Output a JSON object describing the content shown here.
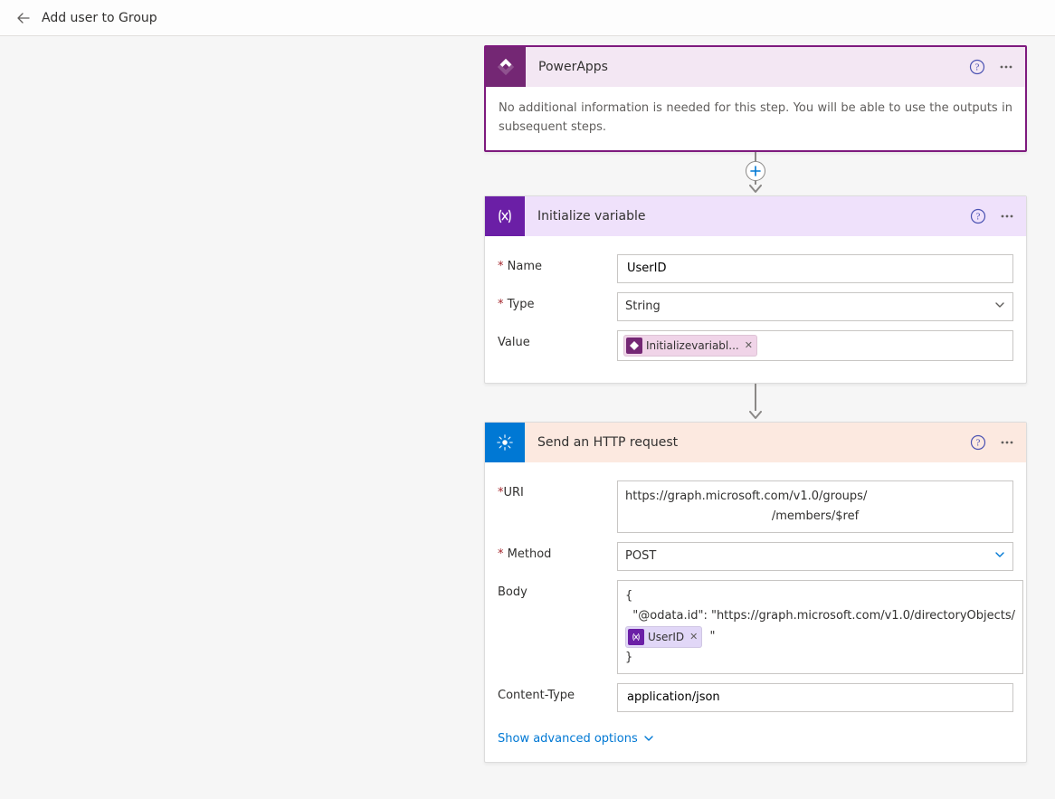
{
  "topbar": {
    "title": "Add user to Group"
  },
  "powerapps": {
    "title": "PowerApps",
    "body": "No additional information is needed for this step. You will be able to use the outputs in subsequent steps."
  },
  "init_var": {
    "title": "Initialize variable",
    "labels": {
      "name": "Name",
      "type": "Type",
      "value": "Value"
    },
    "name_value": "UserID",
    "type_value": "String",
    "value_token": "Initializevariabl..."
  },
  "http": {
    "title": "Send an HTTP request",
    "labels": {
      "uri": "URI",
      "method": "Method",
      "body": "Body",
      "content_type": "Content-Type"
    },
    "uri_line1": "https://graph.microsoft.com/v1.0/groups/",
    "uri_line2": "/members/$ref",
    "method_value": "POST",
    "body_line1": "{",
    "body_line2_prefix": "  \"@odata.id\": \"https://graph.microsoft.com/v1.0/directoryObjects/",
    "body_token": "UserID",
    "body_line2_suffix": " \"",
    "body_line3": "}",
    "content_type_value": "application/json",
    "adv_link": "Show advanced options"
  }
}
